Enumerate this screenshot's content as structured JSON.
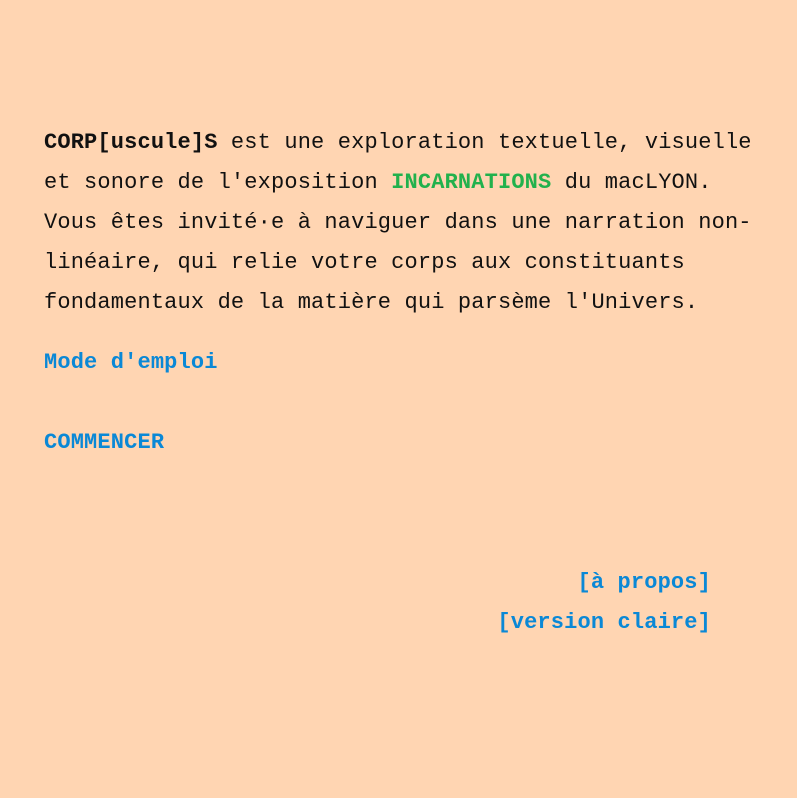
{
  "intro": {
    "project_name": "CORP[uscule]S",
    "text_1": " est une exploration textuelle, visuelle et sonore de l'exposition ",
    "exhibition_name": "INCARNATIONS",
    "text_2": " du macLYON.",
    "text_3": "Vous êtes invité·e à naviguer dans une narration non-linéaire, qui relie votre corps aux constituants fondamentaux de la matière qui parsème l'Univers."
  },
  "links": {
    "mode_emploi": "Mode d'emploi",
    "commencer": "COMMENCER",
    "a_propos": "[à propos]",
    "version_claire": "[version claire]"
  },
  "colors": {
    "background": "#ffd5b2",
    "link": "#0a88d6",
    "accent": "#22b14c",
    "text": "#111111"
  }
}
